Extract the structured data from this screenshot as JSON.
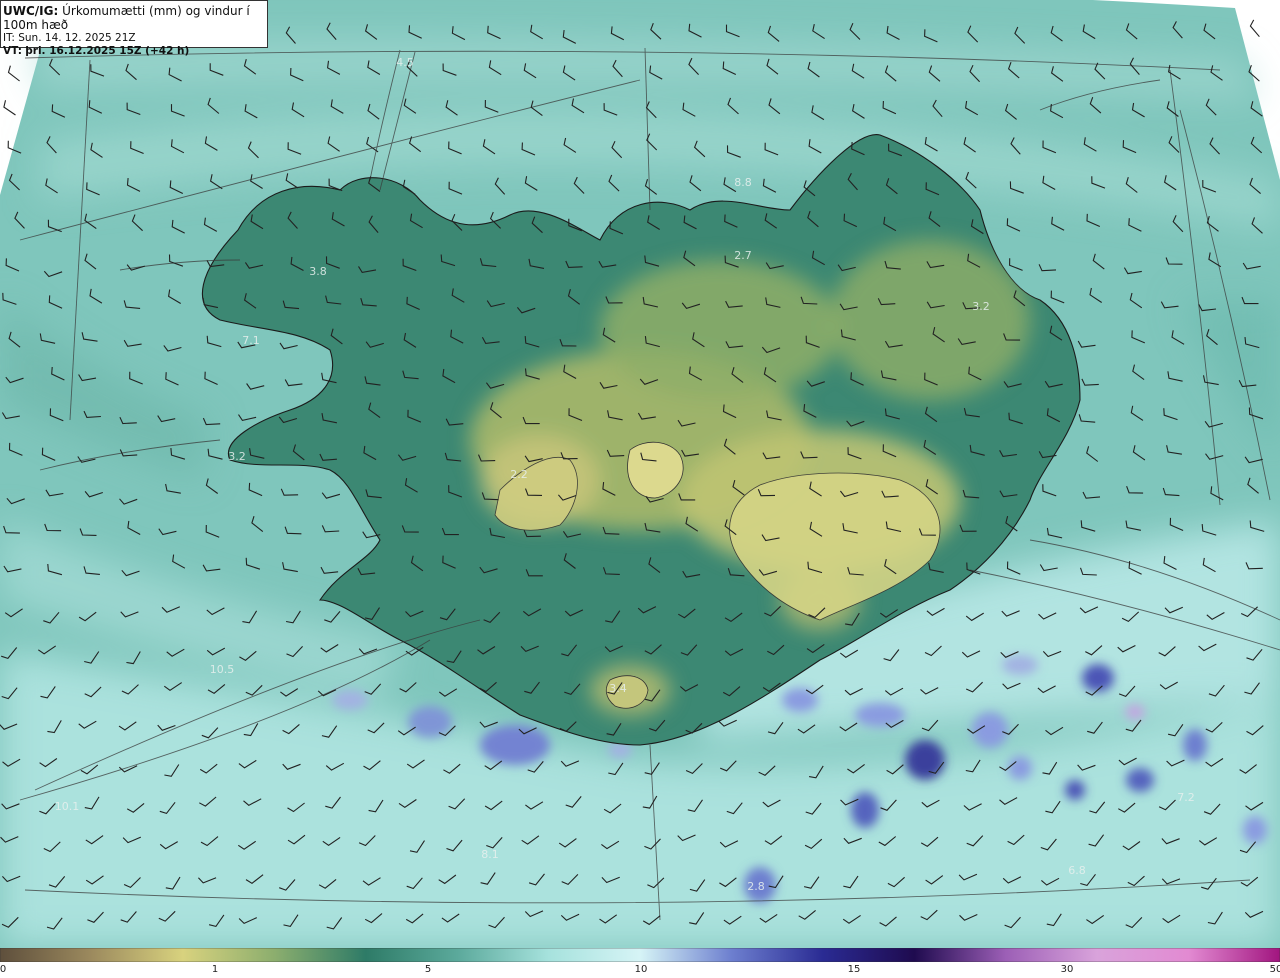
{
  "header": {
    "model": "UWC/IG:",
    "title": "Úrkomumætti (mm) og vindur í 100m hæð",
    "issue_time": "IT: Sun. 14. 12. 2025 21Z",
    "valid_prefix": "VT:",
    "valid_time": "þri. 16.12.2025 15Z (+42 h)"
  },
  "colorbar": {
    "ticks": [
      "0",
      "1",
      "5",
      "10",
      "15",
      "30",
      "50"
    ],
    "colors": [
      "#5e4f3c",
      "#9c8a5e",
      "#d8d27e",
      "#8cae6e",
      "#2e7b67",
      "#5ba99b",
      "#a6e2dd",
      "#d6f4f6",
      "#6d7fcf",
      "#2a2b93",
      "#1f0b4f",
      "#9c5fb6",
      "#d9a3db",
      "#e28ad2",
      "#a1157f"
    ]
  },
  "map": {
    "ocean_color": "#7fc6bc",
    "land_color": "#3c8873",
    "highland_color": "#b9c06e",
    "glacier_color": "#d9d88a",
    "labels": [
      {
        "text": "4.5"
      },
      {
        "text": "3.8"
      },
      {
        "text": "7.1"
      },
      {
        "text": "3.2"
      },
      {
        "text": "2.2"
      },
      {
        "text": "2.7"
      },
      {
        "text": "3.2"
      },
      {
        "text": "3.4"
      },
      {
        "text": "10.5"
      },
      {
        "text": "10.1"
      },
      {
        "text": "8.1"
      },
      {
        "text": "2.8"
      },
      {
        "text": "6.8"
      },
      {
        "text": "7.2"
      },
      {
        "text": "8.8"
      }
    ]
  }
}
